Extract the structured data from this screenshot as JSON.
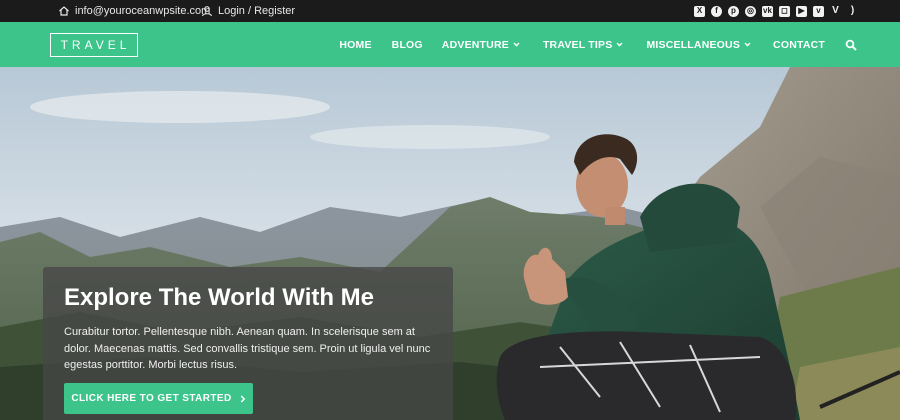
{
  "topbar": {
    "email": "info@youroceanwpsite.com",
    "login": "Login / Register",
    "social_icons": [
      "xing-icon",
      "facebook-icon",
      "pinterest-icon",
      "dribbble-icon",
      "vk-icon",
      "instagram-icon",
      "youtube-icon",
      "vimeo-square-icon",
      "vine-icon",
      "rss-icon"
    ]
  },
  "nav": {
    "logo": "TRAVEL",
    "items": [
      {
        "label": "HOME",
        "has_dropdown": false
      },
      {
        "label": "BLOG",
        "has_dropdown": false
      },
      {
        "label": "ADVENTURE",
        "has_dropdown": true
      },
      {
        "label": "TRAVEL TIPS",
        "has_dropdown": true
      },
      {
        "label": "MISCELLANEOUS",
        "has_dropdown": true
      },
      {
        "label": "CONTACT",
        "has_dropdown": false
      }
    ],
    "search_icon": "search-icon"
  },
  "hero": {
    "title": "Explore The World With Me",
    "text": "Curabitur tortor. Pellentesque nibh. Aenean quam. In scelerisque sem at dolor. Maecenas mattis. Sed convallis tristique sem. Proin ut ligula vel nunc egestas porttitor. Morbi lectus risus.",
    "cta_label": "CLICK HERE TO GET STARTED"
  },
  "colors": {
    "accent": "#3cc48b",
    "topbar": "#1b1b1b"
  }
}
